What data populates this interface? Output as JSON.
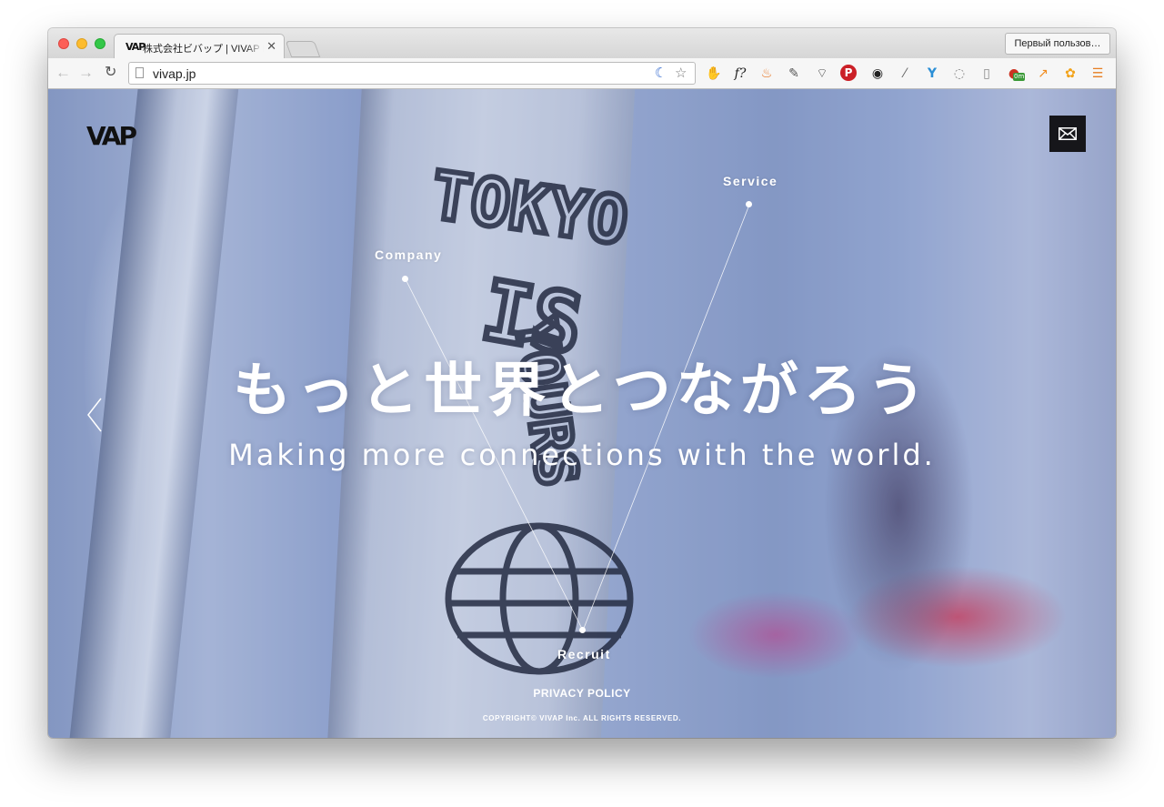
{
  "browser": {
    "tab_title": "株式会社ビバップ | VIVAP Inc.",
    "tab_favicon": "VAP",
    "tab_close": "✕",
    "profile_button": "Первый пользов…",
    "url": "vivap.jp",
    "nav_icons": [
      "back-arrow-icon",
      "forward-arrow-icon",
      "reload-icon"
    ],
    "extensions": [
      "adblock-icon",
      "function-icon",
      "fire-icon",
      "evernote-icon",
      "pocket-icon",
      "pinterest-icon",
      "camera-lens-icon",
      "eyedropper-icon",
      "y-icon",
      "circle-icon",
      "reader-icon",
      "badge-icon",
      "chart-icon",
      "paw-icon",
      "menu-icon"
    ],
    "extension_badge": "0m"
  },
  "site": {
    "logo": "VAP",
    "nav": {
      "company": "Company",
      "service": "Service",
      "recruit": "Recruit"
    },
    "headline_ja": "もっと世界とつながろう",
    "headline_en": "Making more connections with the world.",
    "graffiti": [
      "TOKYO",
      "IS",
      "YOURS"
    ],
    "footer": {
      "privacy": "PRIVACY POLICY",
      "copyright": "COPYRIGHT© VIVAP Inc. ALL RIGHTS RESERVED."
    }
  },
  "colors": {
    "accent_dark": "#16161a",
    "text_light": "#ffffff",
    "bg_blue": "#9fb0d6"
  }
}
